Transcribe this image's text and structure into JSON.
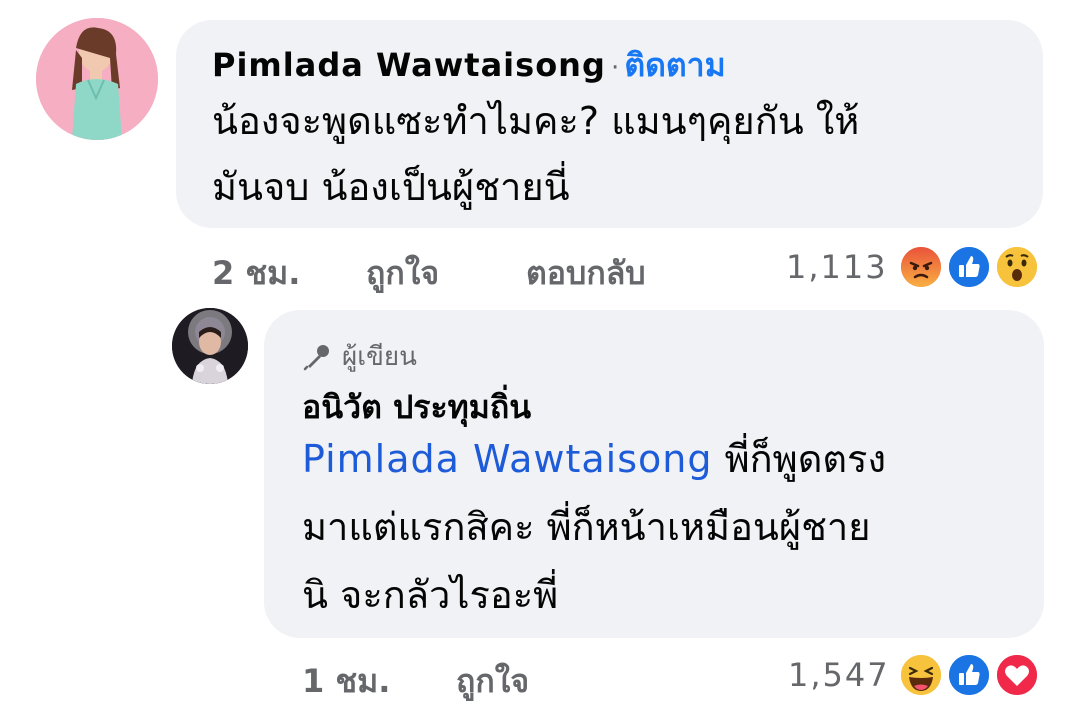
{
  "comment1": {
    "author": "Pimlada Wawtaisong",
    "separator": "·",
    "follow_label": "ติดตาม",
    "text_line1": "น้องจะพูดแซะทำไมคะ? แมนๆคุยกัน ให้",
    "text_line2": "มันจบ น้องเป็นผู้ชายนี่",
    "time": "2 ชม.",
    "like_label": "ถูกใจ",
    "reply_label": "ตอบกลับ",
    "reaction_count": "1,113",
    "reactions": [
      "angry-reaction-icon",
      "like-reaction-icon",
      "wow-reaction-icon"
    ]
  },
  "reply1": {
    "badge_label": "ผู้เขียน",
    "author": "อนิวัต ประทุมถิ่น",
    "mention": "Pimlada Wawtaisong",
    "text_line1_rest": "พี่ก็พูดตรง",
    "text_line2": "มาแต่แรกสิคะ พี่ก็หน้าเหมือนผู้ชาย",
    "text_line3": "นิ จะกลัวไรอะพี่",
    "time": "1 ชม.",
    "like_label": "ถูกใจ",
    "reaction_count": "1,547",
    "reactions": [
      "haha-reaction-icon",
      "like-reaction-icon",
      "love-reaction-icon"
    ]
  },
  "colors": {
    "bubble": "#f0f2f5",
    "link": "#1877f2",
    "meta": "#65676b"
  }
}
